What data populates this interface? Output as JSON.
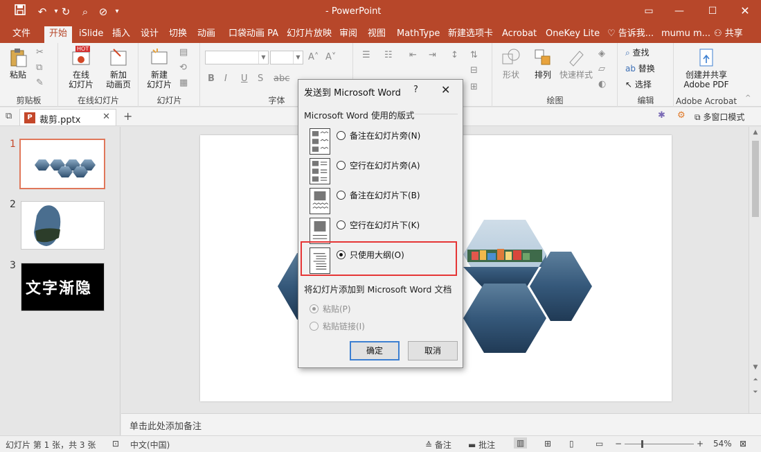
{
  "window": {
    "app_title": "- PowerPoint",
    "restore_icon": "ribbon-display-icon",
    "controls": [
      "minimize",
      "maximize",
      "close"
    ]
  },
  "tabs": [
    "文件",
    "开始",
    "iSlide",
    "插入",
    "设计",
    "切换",
    "动画",
    "口袋动画 PA",
    "幻灯片放映",
    "审阅",
    "视图",
    "MathType",
    "新建选项卡",
    "Acrobat",
    "OneKey Lite",
    "告诉我...",
    "mumu m...",
    "共享"
  ],
  "active_tab": "开始",
  "ribbon": {
    "clipboard": {
      "paste": "粘贴",
      "group": "剪贴板"
    },
    "online": {
      "online_slides": "在线\n幻灯片",
      "new_anim": "新加\n动画页",
      "hot_badge": "HOT",
      "group": "在线幻灯片"
    },
    "slides": {
      "new_slide": "新建\n幻灯片",
      "group": "幻灯片"
    },
    "font": {
      "bold": "B",
      "italic": "I",
      "underline": "U",
      "strike": "S",
      "group": "字体"
    },
    "drawing": {
      "shape": "形状",
      "arrange": "排列",
      "quick_styles": "快速样式",
      "group": "绘图"
    },
    "editing": {
      "find": "查找",
      "replace": "替换",
      "select": "选择",
      "group": "编辑"
    },
    "acrobat": {
      "create": "创建并共享\nAdobe PDF",
      "group": "Adobe Acrobat"
    }
  },
  "docbar": {
    "file_name": "裁剪.pptx",
    "multi_window": "多窗口模式"
  },
  "slides": [
    {
      "num": "1",
      "selected": true
    },
    {
      "num": "2",
      "selected": false
    },
    {
      "num": "3",
      "selected": false,
      "text": "文字渐隐"
    }
  ],
  "notes_placeholder": "单击此处添加备注",
  "status": {
    "slide_info": "幻灯片 第 1 张，共 3 张",
    "language": "中文(中国)",
    "notes": "备注",
    "comments": "批注",
    "zoom": "54%"
  },
  "dialog": {
    "title": "发送到 Microsoft Word",
    "help": "?",
    "layout_section": "Microsoft Word 使用的版式",
    "options": [
      {
        "label": "备注在幻灯片旁(N)",
        "selected": false
      },
      {
        "label": "空行在幻灯片旁(A)",
        "selected": false
      },
      {
        "label": "备注在幻灯片下(B)",
        "selected": false
      },
      {
        "label": "空行在幻灯片下(K)",
        "selected": false
      },
      {
        "label": "只使用大纲(O)",
        "selected": true
      }
    ],
    "add_section": "将幻灯片添加到 Microsoft Word 文档",
    "paste_options": [
      {
        "label": "粘贴(P)",
        "selected": true,
        "disabled": true
      },
      {
        "label": "粘贴链接(I)",
        "selected": false,
        "disabled": true
      }
    ],
    "ok": "确定",
    "cancel": "取消"
  },
  "colors": {
    "accent": "#b7472a",
    "highlight": "#e53535",
    "default_button": "#3c7fd1"
  }
}
